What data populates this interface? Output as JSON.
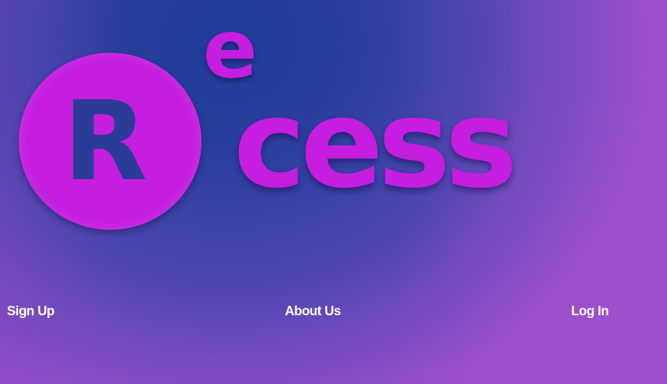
{
  "logo": {
    "circle_letter": "R",
    "superscript": "e",
    "word": "cess",
    "colors": {
      "accent": "#c51ee0",
      "letter": "#2b3b98"
    }
  },
  "nav": {
    "sign_up": "Sign Up",
    "about_us": "About Us",
    "log_in": "Log In"
  }
}
